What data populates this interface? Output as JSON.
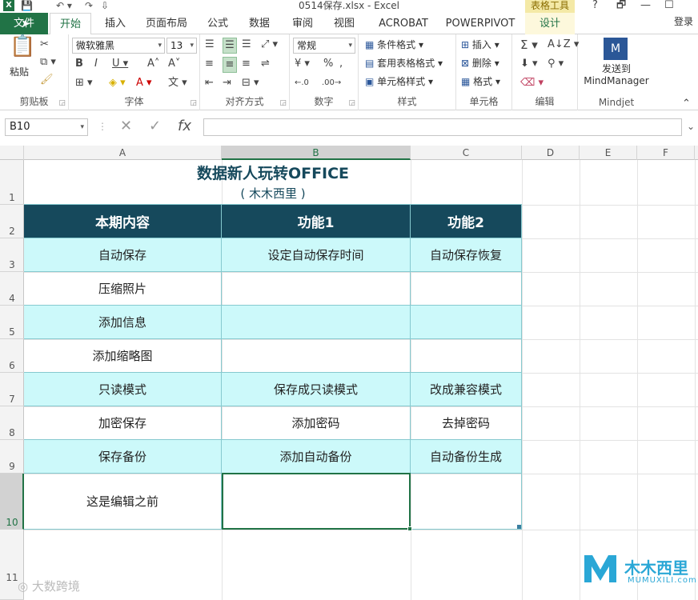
{
  "window": {
    "title": "0514保存.xlsx - Excel",
    "table_tools": "表格工具",
    "help": "?",
    "controls": [
      "🗗",
      "—",
      "☐"
    ]
  },
  "tabs": {
    "file": "文件",
    "home": "开始",
    "insert": "插入",
    "page_layout": "页面布局",
    "formulas": "公式",
    "data": "数据",
    "review": "审阅",
    "view": "视图",
    "acrobat": "ACROBAT",
    "powerpivot": "POWERPIVOT",
    "design": "设计",
    "login": "登录"
  },
  "ribbon": {
    "clipboard": {
      "label": "剪贴板",
      "paste": "粘贴"
    },
    "font": {
      "label": "字体",
      "name": "微软雅黑",
      "size": "13"
    },
    "alignment": {
      "label": "对齐方式"
    },
    "number": {
      "label": "数字",
      "format": "常规"
    },
    "styles": {
      "label": "样式",
      "conditional": "条件格式",
      "as_table": "套用表格格式",
      "cell_styles": "单元格样式"
    },
    "cells": {
      "label": "单元格",
      "insert": "插入",
      "delete": "删除",
      "format": "格式"
    },
    "editing": {
      "label": "编辑"
    },
    "mindjet": {
      "label": "Mindjet",
      "send_line1": "发送到",
      "send_line2": "MindManager"
    }
  },
  "formula_bar": {
    "namebox": "B10",
    "fx": "fx",
    "value": ""
  },
  "columns": [
    "A",
    "B",
    "C",
    "D",
    "E",
    "F"
  ],
  "rows": [
    "1",
    "2",
    "3",
    "4",
    "5",
    "6",
    "7",
    "8",
    "9",
    "10",
    "11"
  ],
  "sheet": {
    "title": "数据新人玩转OFFICE",
    "subtitle": "( 木木西里 )",
    "headers": [
      "本期内容",
      "功能1",
      "功能2"
    ],
    "data": [
      [
        "自动保存",
        "设定自动保存时间",
        "自动保存恢复"
      ],
      [
        "压缩照片",
        "",
        ""
      ],
      [
        "添加信息",
        "",
        ""
      ],
      [
        "添加缩略图",
        "",
        ""
      ],
      [
        "只读模式",
        "保存成只读模式",
        "改成兼容模式"
      ],
      [
        "加密保存",
        "添加密码",
        "去掉密码"
      ],
      [
        "保存备份",
        "添加自动备份",
        "自动备份生成"
      ],
      [
        "这是编辑之前",
        "",
        ""
      ]
    ]
  },
  "watermarks": {
    "left": "大数跨境",
    "right": "木木西里",
    "right_sub": "MUMUXILI.com"
  },
  "colors": {
    "excel_green": "#217346",
    "header_fill": "#16495c",
    "band_fill": "#ccf9fa"
  }
}
